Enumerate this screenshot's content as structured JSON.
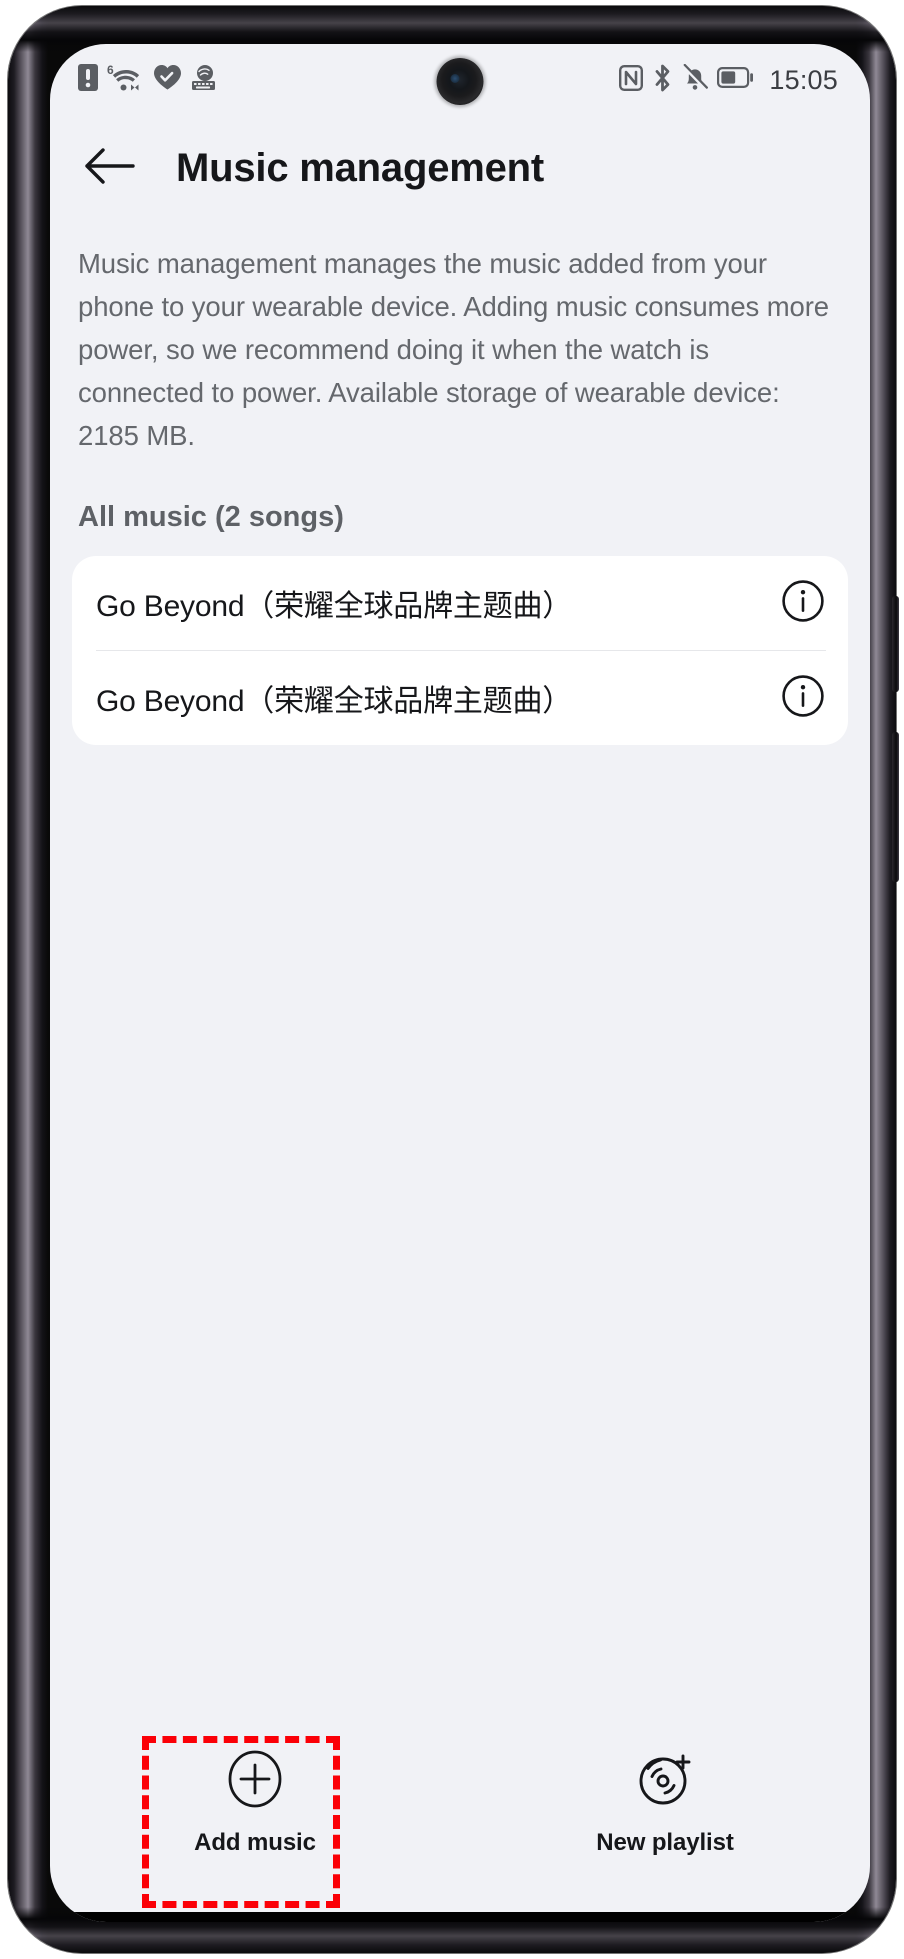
{
  "status_bar": {
    "left_icons": [
      {
        "name": "sim-alert-icon",
        "label": "SIM card alert"
      },
      {
        "name": "wifi-6-icon",
        "label": "Wi-Fi 6",
        "badge": "6"
      },
      {
        "name": "heart-icon",
        "label": "Heart rate"
      },
      {
        "name": "app-notification-icon",
        "label": "App notification"
      }
    ],
    "right_icons": [
      {
        "name": "nfc-icon",
        "label": "NFC"
      },
      {
        "name": "bluetooth-icon",
        "label": "Bluetooth"
      },
      {
        "name": "bell-muted-icon",
        "label": "Silent mode"
      },
      {
        "name": "battery-icon",
        "label": "Battery",
        "level_percent": 52
      }
    ],
    "clock": "15:05"
  },
  "header": {
    "back_icon": "arrow-left-icon",
    "title": "Music management"
  },
  "description": "Music management manages the music added from your phone to your wearable device. Adding music consumes more power, so we recommend doing it when the watch is connected to power. Available storage of wearable device: 2185 MB.",
  "section": {
    "heading": "All music (2 songs)"
  },
  "songs": [
    {
      "title": "Go Beyond（荣耀全球品牌主题曲）",
      "info_icon": "info-circle-icon"
    },
    {
      "title": "Go Beyond（荣耀全球品牌主题曲）",
      "info_icon": "info-circle-icon"
    }
  ],
  "bottom_bar": {
    "actions": [
      {
        "label": "Add music",
        "icon": "plus-circle-icon",
        "highlighted": true
      },
      {
        "label": "New playlist",
        "icon": "new-playlist-disc-icon",
        "highlighted": false
      }
    ]
  },
  "colors": {
    "screen_background": "#f1f2f6",
    "card_background": "#ffffff",
    "primary_text": "#16171a",
    "secondary_text": "#65686d",
    "highlight_red": "#fb0007",
    "divider": "#e6e7ea"
  }
}
